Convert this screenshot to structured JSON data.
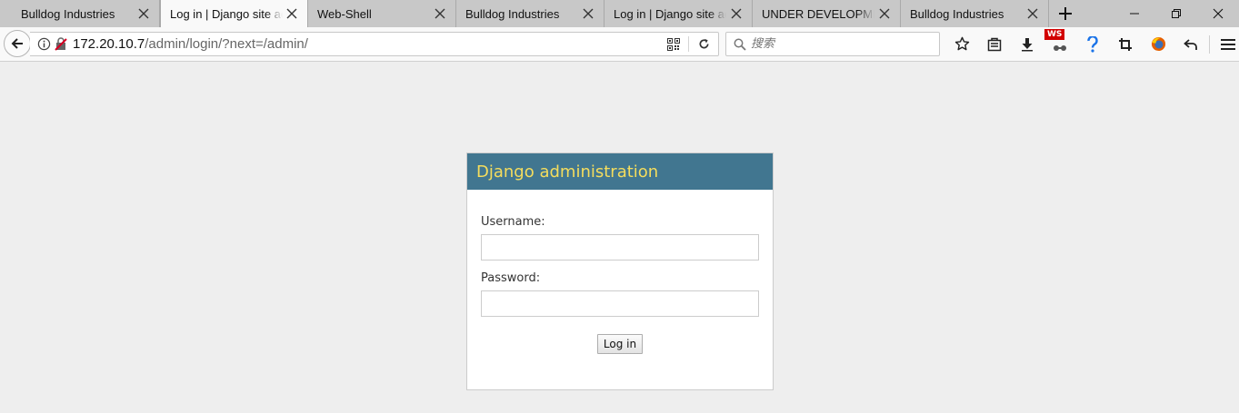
{
  "browser": {
    "tabs": [
      {
        "title": "Bulldog Industries",
        "active": false
      },
      {
        "title": "Log in | Django site admin",
        "active": true
      },
      {
        "title": "Web-Shell",
        "active": false
      },
      {
        "title": "Bulldog Industries",
        "active": false
      },
      {
        "title": "Log in | Django site admin",
        "active": false
      },
      {
        "title": "UNDER DEVELOPMENT",
        "active": false
      },
      {
        "title": "Bulldog Industries",
        "active": false
      }
    ],
    "url_host": "172.20.10.7",
    "url_path": "/admin/login/?next=/admin/",
    "search_placeholder": "搜索",
    "ws_badge": "WS",
    "icons": [
      "back-arrow-icon",
      "info-icon",
      "insecure-lock-icon",
      "qr-code-icon",
      "reload-icon",
      "search-icon",
      "star-icon",
      "reading-list-icon",
      "download-icon",
      "ws-extension-icon",
      "help-icon",
      "crop-icon",
      "firefox-icon",
      "undo-icon",
      "hamburger-menu-icon"
    ]
  },
  "login": {
    "header": "Django administration",
    "username_label": "Username:",
    "password_label": "Password:",
    "submit_label": "Log in"
  },
  "colors": {
    "header_bg": "#417690",
    "header_text": "#f5dd5d",
    "page_bg": "#eeeeee"
  }
}
